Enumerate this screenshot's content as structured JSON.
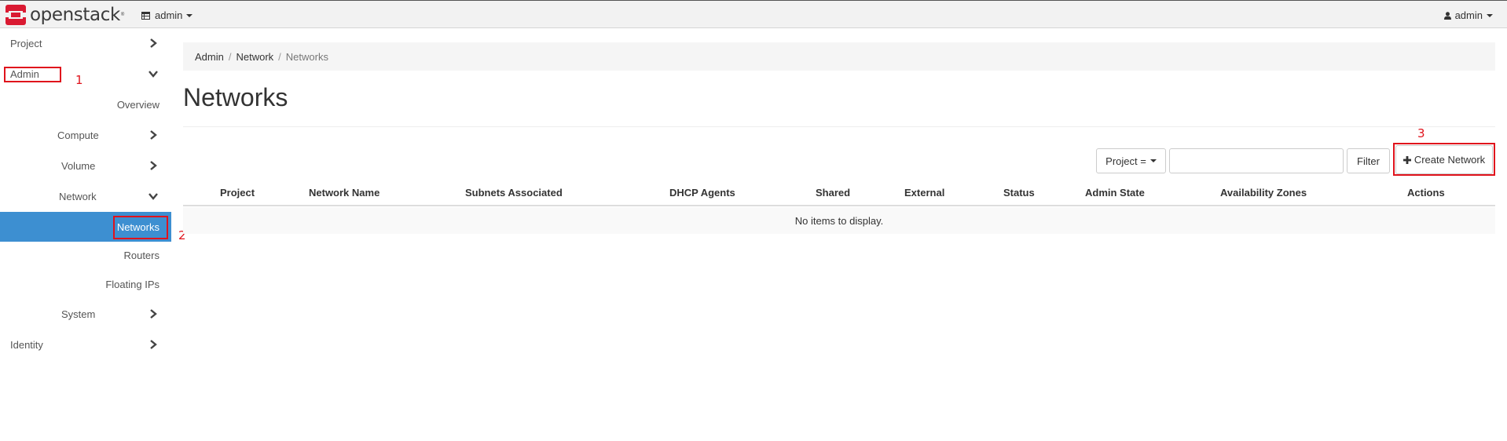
{
  "navbar": {
    "brand": "openstack",
    "brand_tm": "®",
    "project_switcher": "admin",
    "user_menu": "admin"
  },
  "sidebar": {
    "project": "Project",
    "admin": "Admin",
    "overview": "Overview",
    "compute": "Compute",
    "volume": "Volume",
    "network": "Network",
    "networks": "Networks",
    "routers": "Routers",
    "floating_ips": "Floating IPs",
    "system": "System",
    "identity": "Identity"
  },
  "annotations": {
    "step1": "1",
    "step2": "2",
    "step3": "3"
  },
  "breadcrumb": {
    "admin": "Admin",
    "network": "Network",
    "networks": "Networks",
    "separator": "/"
  },
  "page_title": "Networks",
  "filter": {
    "field_select": "Project =",
    "value": "",
    "button": "Filter"
  },
  "create_button": "Create Network",
  "table": {
    "columns": [
      "Project",
      "Network Name",
      "Subnets Associated",
      "DHCP Agents",
      "Shared",
      "External",
      "Status",
      "Admin State",
      "Availability Zones",
      "Actions"
    ],
    "empty_message": "No items to display."
  },
  "colors": {
    "active_nav": "#3d8fd1",
    "annotation": "#e0131c",
    "brand_red": "#da1a32"
  },
  "icons": {
    "brand_logo": "openstack-logo-icon",
    "project_switcher": "table-icon",
    "user": "user-icon",
    "expand": "chevron-right-icon",
    "collapse": "chevron-down-icon",
    "create": "plus-icon"
  }
}
